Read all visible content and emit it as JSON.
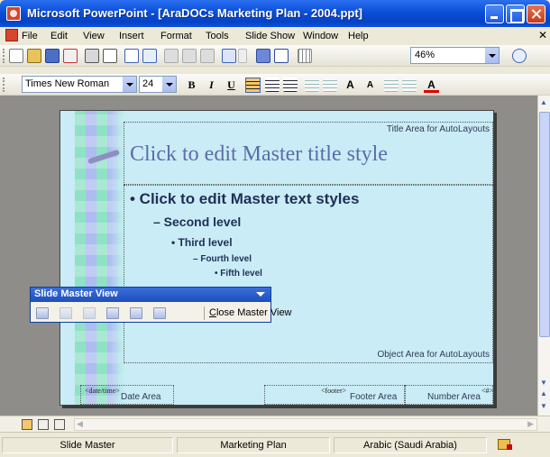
{
  "window": {
    "title": "Microsoft PowerPoint - [AraDOCs Marketing Plan - 2004.ppt]",
    "app_icon": "powerpoint-icon"
  },
  "menu": {
    "items": [
      "File",
      "Edit",
      "View",
      "Insert",
      "Format",
      "Tools",
      "Slide Show",
      "Window",
      "Help"
    ]
  },
  "standard_toolbar": {
    "icons": [
      "new-icon",
      "open-icon",
      "save-icon",
      "permission-icon",
      "print-icon",
      "print-preview-icon",
      "spelling-icon",
      "research-icon",
      "cut-icon",
      "copy-icon",
      "format-painter-icon",
      "undo-icon",
      "undo-dropdown-icon",
      "insert-chart-icon",
      "insert-table-icon",
      "show-grid-icon",
      "help-icon"
    ],
    "zoom": "46%"
  },
  "formatting_toolbar": {
    "font": "Times New Roman",
    "size": "24",
    "bold": "B",
    "italic": "I",
    "underline": "U",
    "icons": [
      "align-left-icon",
      "center-icon",
      "align-right-icon",
      "numbering-icon",
      "bullets-icon",
      "increase-font-icon",
      "decrease-font-icon",
      "decrease-indent-icon",
      "increase-indent-icon",
      "font-color-icon"
    ]
  },
  "slide": {
    "title_area_label": "Title Area for AutoLayouts",
    "title_text": "Click to edit Master title style",
    "level1": "• Click to edit Master text styles",
    "level2": "– Second level",
    "level3": "• Third level",
    "level4": "– Fourth level",
    "level5": "• Fifth level",
    "object_area_label": "Object Area for AutoLayouts",
    "date_placeholder": "<date/time>",
    "date_area_label": "Date Area",
    "footer_placeholder": "<footer>",
    "footer_area_label": "Footer Area",
    "number_placeholder": "<#>",
    "number_area_label": "Number Area",
    "colors": {
      "background": "#c9ecf6",
      "title_text": "#5d6ca8",
      "body_text": "#1f2f55"
    }
  },
  "master_view_toolbar": {
    "title": "Slide Master View",
    "icons": [
      "insert-new-slide-master-icon",
      "insert-new-title-master-icon",
      "delete-master-icon",
      "preserve-master-icon",
      "rename-master-icon",
      "master-layout-icon"
    ],
    "close_label": "Close Master View"
  },
  "view_buttons": [
    "normal-view-icon",
    "slide-sorter-view-icon",
    "slide-show-icon"
  ],
  "status": {
    "view": "Slide Master",
    "design": "Marketing Plan",
    "language": "Arabic (Saudi Arabia)",
    "spelling_icon": "spelling-status-icon"
  }
}
